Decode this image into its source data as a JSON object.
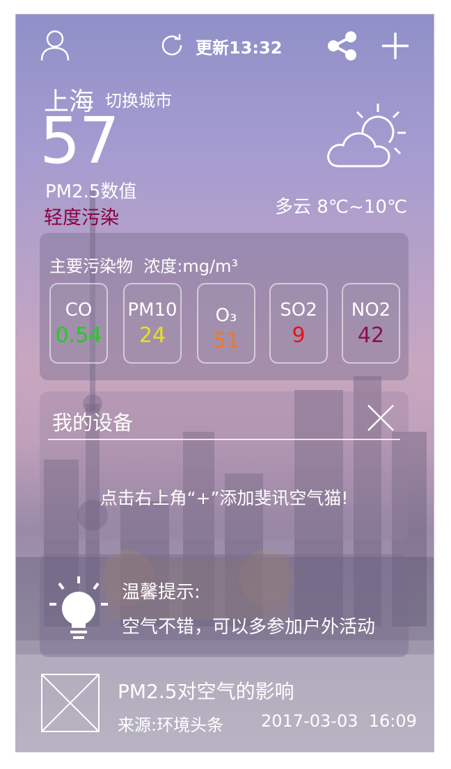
{
  "header": {
    "update_text": "更新13:32",
    "icons": [
      "user-icon",
      "refresh-icon",
      "share-icon",
      "plus-icon"
    ]
  },
  "city": {
    "name": "上海",
    "switch_label": "切换城市",
    "aqi_value": "57",
    "aqi_label": "PM2.5数值",
    "level_text": "轻度污染",
    "level_color": "#8b0040"
  },
  "weather": {
    "text": "多云 8℃~10℃",
    "icon": "partly-cloudy-icon"
  },
  "pollutants": {
    "title": "主要污染物  浓度:mg/m³",
    "items": [
      {
        "name": "CO",
        "value": "0.54",
        "color": "#19d219"
      },
      {
        "name": "PM10",
        "value": "24",
        "color": "#e7e21b"
      },
      {
        "name": "O₃",
        "value": "51",
        "color": "#f07820"
      },
      {
        "name": "SO2",
        "value": "9",
        "color": "#e8121b"
      },
      {
        "name": "NO2",
        "value": "42",
        "color": "#8e0f4a"
      }
    ]
  },
  "devices": {
    "title": "我的设备",
    "hint": "点击右上角“+”添加斐讯空气猫!"
  },
  "tip": {
    "title": "温馨提示:",
    "text": "空气不错，可以多参加户外活动"
  },
  "news": {
    "title": "PM2.5对空气的影响",
    "source": "来源:环境头条",
    "datetime": "2017-03-03  16:09"
  }
}
